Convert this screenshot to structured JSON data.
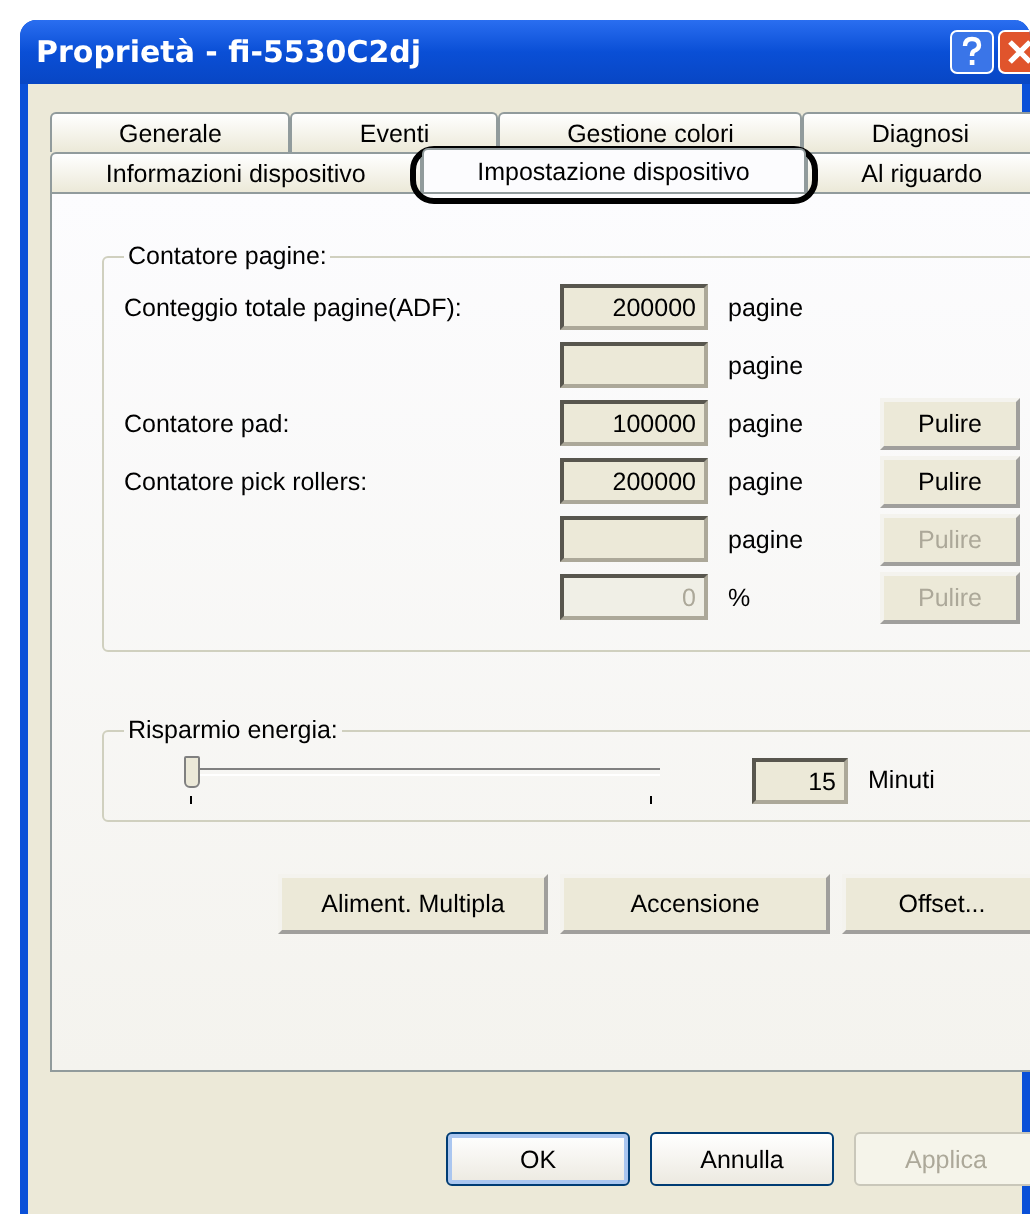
{
  "window": {
    "title": "Proprietà - fi-5530C2dj"
  },
  "tab_rows": [
    [
      {
        "label": "Generale",
        "selected": false
      },
      {
        "label": "Eventi",
        "selected": false
      },
      {
        "label": "Gestione colori",
        "selected": false
      },
      {
        "label": "Diagnosi",
        "selected": false
      }
    ],
    [
      {
        "label": "Informazioni dispositivo",
        "selected": false
      },
      {
        "label": "Impostazione dispositivo",
        "selected": true,
        "circled": true
      },
      {
        "label": "Al riguardo",
        "selected": false
      }
    ]
  ],
  "page_counter": {
    "title": "Contatore pagine:",
    "rows": [
      {
        "label": "Conteggio totale pagine(ADF):",
        "value": "200000",
        "unit": "pagine",
        "disabled": false
      },
      {
        "unit": "pagine",
        "disabled": false
      },
      {
        "label": "Contatore pad:",
        "value": "100000",
        "unit": "pagine",
        "disabled": false,
        "button": {
          "label": "Pulire",
          "disabled": false
        }
      },
      {
        "label": "Contatore pick rollers:",
        "value": "200000",
        "unit": "pagine",
        "disabled": false,
        "button": {
          "label": "Pulire",
          "disabled": false
        }
      },
      {
        "unit": "pagine",
        "disabled": false,
        "button": {
          "label": "Pulire",
          "disabled": true
        }
      },
      {
        "value": "0",
        "unit": "%",
        "disabled": true,
        "button": {
          "label": "Pulire",
          "disabled": true
        }
      }
    ]
  },
  "energy_saving": {
    "title": "Risparmio energia:",
    "level": 0,
    "value": "15",
    "unit": "Minuti"
  },
  "action_buttons": [
    {
      "label": "Aliment. Multipla"
    },
    {
      "label": "Accensione"
    },
    {
      "label": "Offset..."
    }
  ],
  "dialog_buttons": [
    {
      "label": "OK",
      "disabled": false,
      "default": true
    },
    {
      "label": "Annulla",
      "disabled": false,
      "default": false
    },
    {
      "label": "Applica",
      "disabled": true,
      "default": false
    }
  ]
}
